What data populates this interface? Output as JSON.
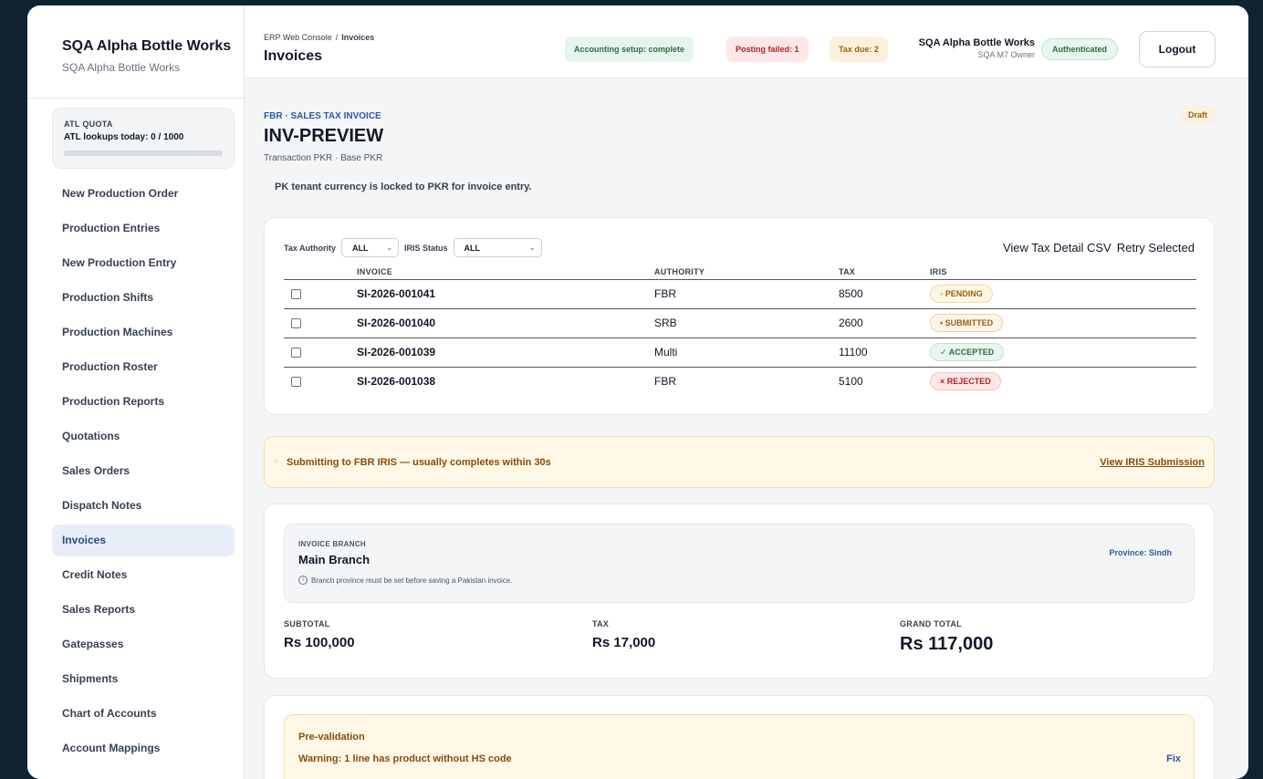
{
  "sidebar": {
    "brand_title": "SQA Alpha Bottle Works",
    "brand_sub": "SQA Alpha Bottle Works",
    "quota": {
      "title": "ATL QUOTA",
      "line": "ATL lookups today: 0 / 1000",
      "used": 0,
      "limit": 1000
    },
    "items": [
      {
        "label": "New Production Order"
      },
      {
        "label": "Production Entries"
      },
      {
        "label": "New Production Entry"
      },
      {
        "label": "Production Shifts"
      },
      {
        "label": "Production Machines"
      },
      {
        "label": "Production Roster"
      },
      {
        "label": "Production Reports"
      },
      {
        "label": "Quotations"
      },
      {
        "label": "Sales Orders"
      },
      {
        "label": "Dispatch Notes"
      },
      {
        "label": "Invoices"
      },
      {
        "label": "Credit Notes"
      },
      {
        "label": "Sales Reports"
      },
      {
        "label": "Gatepasses"
      },
      {
        "label": "Shipments"
      },
      {
        "label": "Chart of Accounts"
      },
      {
        "label": "Account Mappings"
      }
    ]
  },
  "header": {
    "breadcrumb_root": "ERP Web Console",
    "breadcrumb_sep": "/",
    "breadcrumb_current": "Invoices",
    "title": "Invoices",
    "pills": {
      "accounting": "Accounting setup: complete",
      "posting": "Posting failed: 1",
      "tax_due": "Tax due: 2"
    },
    "user_name": "SQA Alpha Bottle Works",
    "user_role": "SQA M7 Owner",
    "auth": "Authenticated",
    "logout": "Logout"
  },
  "invoice": {
    "kicker": "FBR · SALES TAX INVOICE",
    "status": "Draft",
    "number": "INV-PREVIEW",
    "currency_line": "Transaction PKR · Base PKR",
    "note": "PK tenant currency is locked to PKR for invoice entry."
  },
  "table": {
    "filter_authority_label": "Tax Authority",
    "filter_authority_value": "ALL",
    "filter_iris_label": "IRIS Status",
    "filter_iris_value": "ALL",
    "action_csv": "View Tax Detail CSV",
    "action_retry": "Retry Selected",
    "columns": [
      "INVOICE",
      "AUTHORITY",
      "TAX",
      "IRIS"
    ],
    "rows": [
      {
        "invoice": "SI-2026-001041",
        "authority": "FBR",
        "tax": "8500",
        "iris": "◦ PENDING",
        "iris_key": "pending"
      },
      {
        "invoice": "SI-2026-001040",
        "authority": "SRB",
        "tax": "2600",
        "iris": "• SUBMITTED",
        "iris_key": "submitted"
      },
      {
        "invoice": "SI-2026-001039",
        "authority": "Multi",
        "tax": "11100",
        "iris": "✓ ACCEPTED",
        "iris_key": "accepted"
      },
      {
        "invoice": "SI-2026-001038",
        "authority": "FBR",
        "tax": "5100",
        "iris": "× REJECTED",
        "iris_key": "rejected"
      }
    ]
  },
  "banner": {
    "text": "Submitting to FBR IRIS — usually completes within 30s",
    "link": "View IRIS Submission"
  },
  "branch": {
    "label": "INVOICE BRANCH",
    "name": "Main Branch",
    "hint": "Branch province must be set before saving a Pakistan invoice.",
    "province": "Province: Sindh"
  },
  "totals": {
    "subtotal_label": "SUBTOTAL",
    "subtotal": "Rs 100,000",
    "tax_label": "TAX",
    "tax": "Rs 17,000",
    "grand_label": "GRAND TOTAL",
    "grand": "Rs 117,000"
  },
  "prevalidation": {
    "title": "Pre-validation",
    "warning": "Warning: 1 line has product without HS code",
    "fix": "Fix"
  },
  "colors": {
    "accent": "#2b5aa6",
    "active_nav_bg": "#e7eef8",
    "warning_bg": "#fff8e6",
    "warning_text": "#8a4b0b",
    "success": "#2f6b47",
    "danger": "#b42323"
  }
}
